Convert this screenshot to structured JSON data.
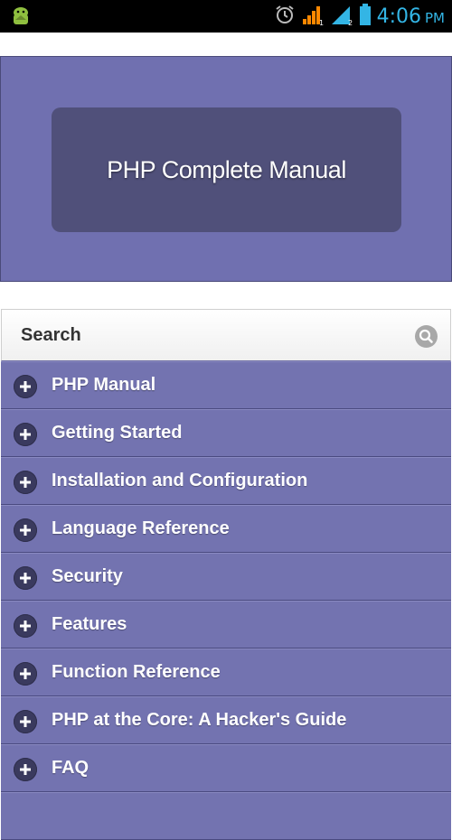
{
  "status_bar": {
    "time": "4:06",
    "ampm": "PM",
    "left_icon": "android-debug-icon",
    "right_icons": [
      "alarm-icon",
      "signal-1-icon",
      "signal-2-icon",
      "battery-icon"
    ]
  },
  "header": {
    "title": "PHP Complete Manual"
  },
  "search": {
    "label": "Search",
    "icon": "search-icon"
  },
  "menu": {
    "items": [
      {
        "label": "PHP Manual"
      },
      {
        "label": "Getting Started"
      },
      {
        "label": "Installation and Configuration"
      },
      {
        "label": "Language Reference"
      },
      {
        "label": "Security"
      },
      {
        "label": "Features"
      },
      {
        "label": "Function Reference"
      },
      {
        "label": "PHP at the Core: A Hacker's Guide"
      },
      {
        "label": "FAQ"
      }
    ]
  },
  "colors": {
    "accent": "#7373b0",
    "card": "#50507a",
    "status_time": "#33b5e5"
  }
}
